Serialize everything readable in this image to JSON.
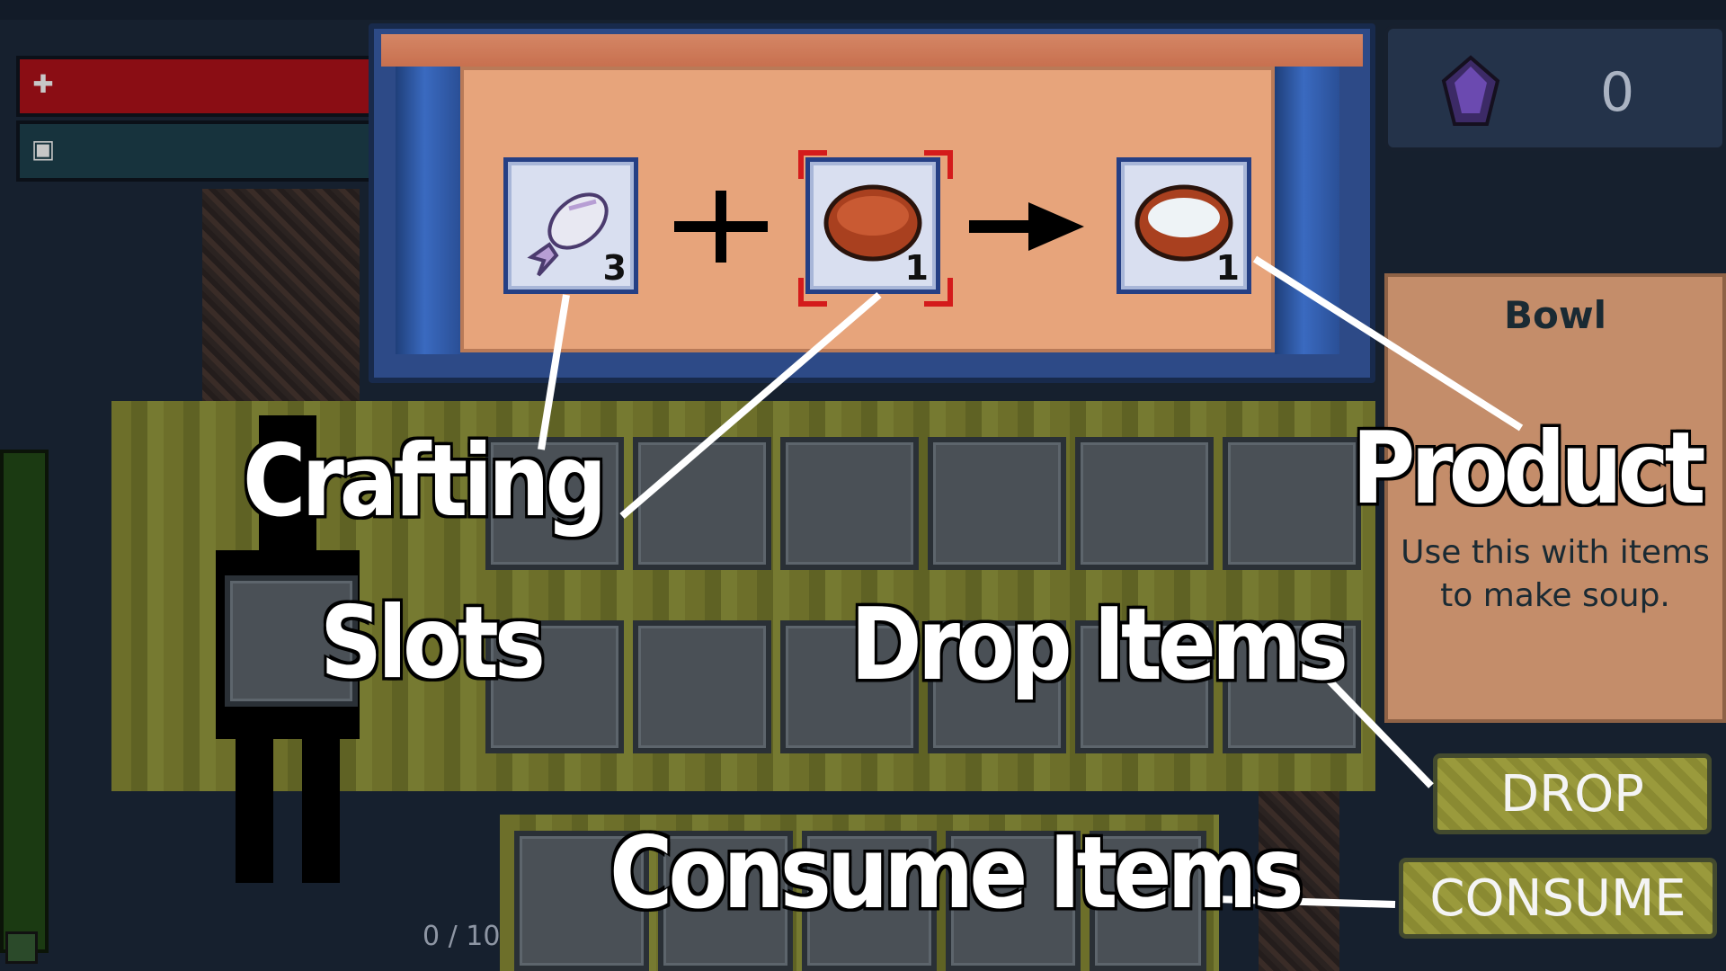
{
  "currency": {
    "icon": "purple-gem-icon",
    "count": "0"
  },
  "crafting": {
    "slots": [
      {
        "item": "fish",
        "icon": "fish-icon",
        "count": "3"
      },
      {
        "item": "bowl",
        "icon": "bowl-icon",
        "count": "1",
        "selected": true
      }
    ],
    "product": {
      "item": "bowl-of-water",
      "icon": "water-bowl-icon",
      "count": "1"
    },
    "operator_icon": "plus-icon",
    "arrow_icon": "arrow-right-icon"
  },
  "info": {
    "title": "Bowl",
    "description_line1": "Use this with items",
    "description_line2": "to make soup."
  },
  "hotbar": {
    "capacity": "0 / 10"
  },
  "buttons": {
    "drop": "DROP",
    "consume": "CONSUME"
  },
  "annotations": {
    "crafting_line1": "Crafting",
    "crafting_line2": "Slots",
    "product": "Product",
    "drop_items": "Drop Items",
    "consume_items": "Consume Items"
  },
  "colors": {
    "health": "#8a0d14",
    "craft_frame": "#2d4a87",
    "craft_bg": "#e7a47b",
    "inventory": "#6d6f2a",
    "selection": "#d41b1b"
  }
}
